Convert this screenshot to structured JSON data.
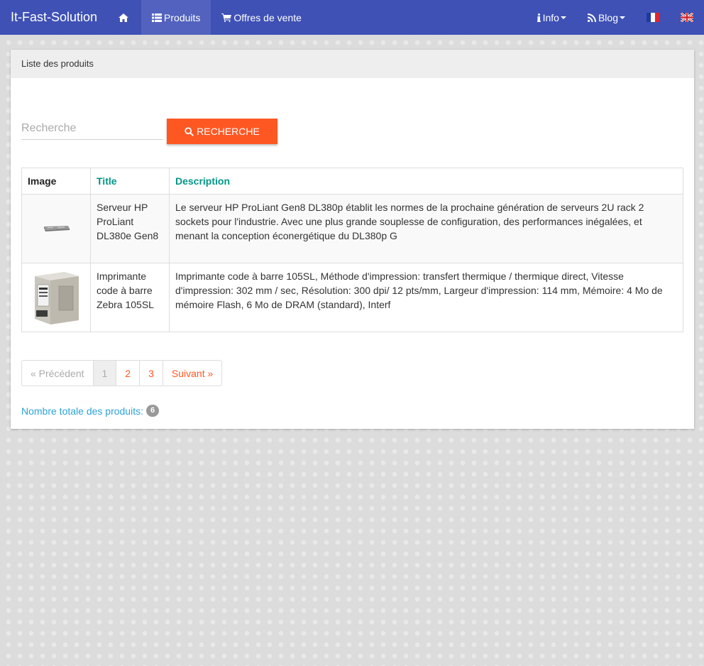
{
  "navbar": {
    "brand": "It-Fast-Solution",
    "home_icon": "home-icon",
    "items": [
      {
        "label": "Produits",
        "icon": "list-icon",
        "active": true
      },
      {
        "label": "Offres de vente",
        "icon": "cart-icon",
        "active": false
      }
    ],
    "right": [
      {
        "label": "Info",
        "icon": "info-icon"
      },
      {
        "label": "Blog",
        "icon": "rss-icon"
      }
    ],
    "flags": [
      "flag-fr-icon",
      "flag-uk-icon"
    ],
    "color": "#3f51b5"
  },
  "panel": {
    "heading": "Liste des produits"
  },
  "search": {
    "placeholder": "Recherche",
    "value": "",
    "button_label": "RECHERCHE",
    "button_color": "#ff5722"
  },
  "table": {
    "headers": {
      "image": "Image",
      "title": "Title",
      "description": "Description"
    },
    "rows": [
      {
        "image": "server-image",
        "title": "Serveur HP ProLiant DL380e Gen8",
        "description": "Le serveur HP ProLiant Gen8 DL380p établit les normes de la prochaine génération de serveurs 2U rack 2 sockets pour l'industrie. Avec une plus grande souplesse de configuration, des performances inégalées, et menant la conception éconergétique du DL380p G"
      },
      {
        "image": "printer-image",
        "title": "Imprimante code à barre Zebra 105SL",
        "description": "Imprimante code à barre 105SL, Méthode d'impression: transfert thermique / thermique direct, Vitesse d'impression: 302 mm / sec, Résolution: 300 dpi/ 12 pts/mm, Largeur d'impression: 114 mm, Mémoire: 4 Mo de mémoire Flash, 6 Mo de DRAM (standard), Interf"
      }
    ]
  },
  "pagination": {
    "prev": "« Précédent",
    "pages": [
      "1",
      "2",
      "3"
    ],
    "current": "1",
    "next": "Suivant »"
  },
  "total": {
    "label": "Nombre totale des produits:",
    "count": "6"
  }
}
